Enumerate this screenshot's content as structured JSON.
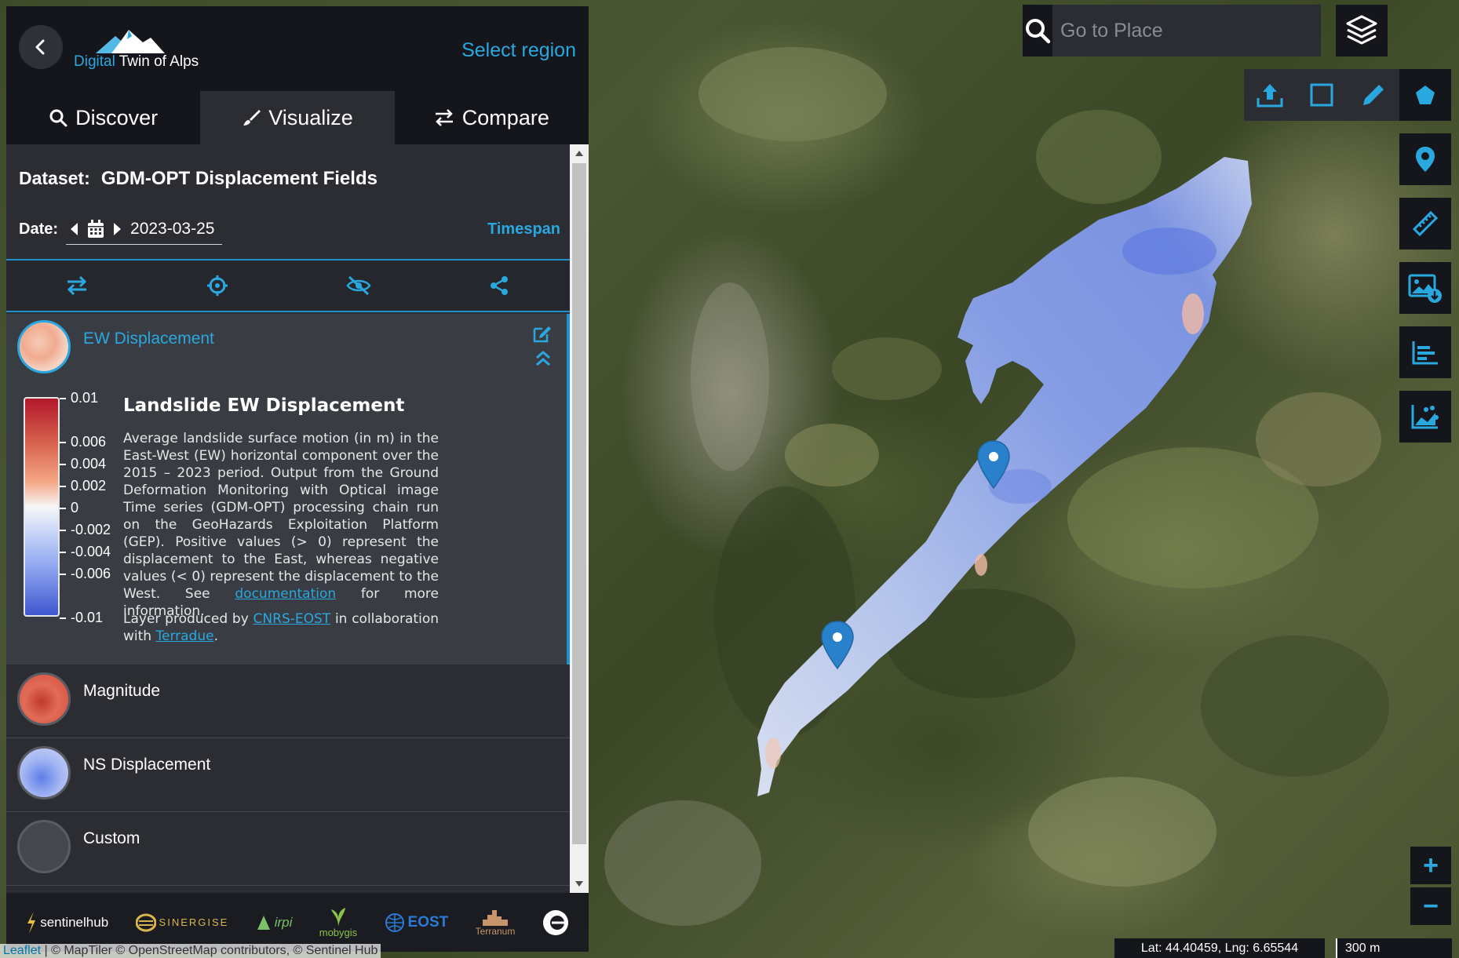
{
  "app": {
    "logo_accent": "Digital",
    "logo_rest": " Twin of Alps",
    "select_region": "Select region"
  },
  "tabs": [
    {
      "label": "Discover",
      "icon": "search-icon",
      "active": false
    },
    {
      "label": "Visualize",
      "icon": "brush-icon",
      "active": true
    },
    {
      "label": "Compare",
      "icon": "swap-icon",
      "active": false
    }
  ],
  "dataset": {
    "label": "Dataset:",
    "name": "GDM-OPT Displacement Fields"
  },
  "date": {
    "label": "Date:",
    "value": "2023-03-25",
    "timespan": "Timespan"
  },
  "tools": [
    "swap-icon",
    "crosshair-icon",
    "eye-slash-icon",
    "share-icon"
  ],
  "layers": {
    "expanded": {
      "name": "EW Displacement",
      "legend_ticks": [
        "0.01",
        "0.006",
        "0.004",
        "0.002",
        "0",
        "-0.002",
        "-0.004",
        "-0.006",
        "-0.01"
      ],
      "legend_tick_fraction": [
        0.0,
        0.2,
        0.3,
        0.4,
        0.5,
        0.6,
        0.7,
        0.8,
        1.0
      ],
      "title": "Landslide EW Displacement",
      "description_before_link": "Average landslide surface motion (in m) in the East-West (EW) horizontal component over the 2015 – 2023 period. Output from the Ground Deformation Monitoring with Optical image Time series (GDM-OPT) processing chain run on the GeoHazards Exploitation Platform (GEP). Positive values (> 0) represent the displacement to the East, whereas negative values (< 0) represent the displacement to the West. See ",
      "description_link": "documentation",
      "description_after_link": " for more information.",
      "credit_before": "Layer produced by ",
      "credit_link_1": "CNRS-EOST",
      "credit_middle": " in collaboration with ",
      "credit_link_2": "Terradue",
      "credit_after": "."
    },
    "others": [
      {
        "name": "Magnitude"
      },
      {
        "name": "NS Displacement"
      },
      {
        "name": "Custom"
      }
    ]
  },
  "partner_logos": [
    {
      "text": "sentinelhub"
    },
    {
      "text": "SINERGISE"
    },
    {
      "text": "irpi"
    },
    {
      "text": "mobygis"
    },
    {
      "text": "EOST"
    },
    {
      "text": "Terranum"
    },
    {
      "text": ""
    }
  ],
  "map": {
    "search_placeholder": "Go to Place",
    "coords": "Lat: 44.40459, Lng: 6.65544",
    "scale": "300 m",
    "attribution_leaflet": "Leaflet",
    "attribution_rest": " | © MapTiler © OpenStreetMap contributors, © Sentinel Hub",
    "zoom_in": "+",
    "zoom_out": "−"
  },
  "colors": {
    "accent": "#29a8e0",
    "panel_bg": "#2b2d33",
    "header_bg": "#14161c"
  }
}
